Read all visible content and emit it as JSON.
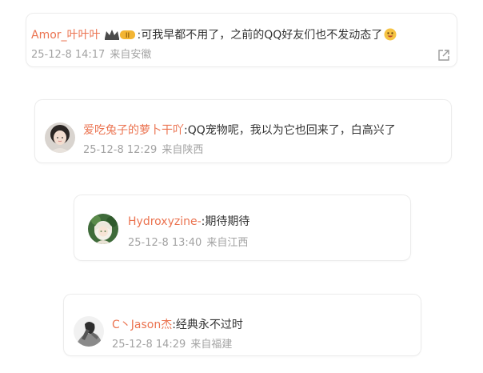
{
  "comments": [
    {
      "username": "Amor_叶叶叶",
      "badge": "II",
      "text": ":可我早都不用了，之前的QQ好友们也不发动态了",
      "time": "25-12-8 14:17",
      "location": "来自安徽",
      "has_emoji": true,
      "emoji_icon": "smile-emoji-icon",
      "has_share": true,
      "share_icon": "share-external-icon"
    },
    {
      "username": "爱吃兔子的萝卜干吖",
      "text": ":QQ宠物呢，我以为它也回来了，白高兴了",
      "time": "25-12-8 12:29",
      "location": "来自陕西",
      "avatar_icon": "avatar-girl-photo"
    },
    {
      "username": "Hydroxyzine-",
      "text": ":期待期待",
      "time": "25-12-8 13:40",
      "location": "来自江西",
      "avatar_icon": "avatar-anime-character"
    },
    {
      "username": "C丶Jason杰",
      "text": ":经典永不过时",
      "time": "25-12-8 14:29",
      "location": "来自福建",
      "avatar_icon": "avatar-sketch-figure"
    }
  ],
  "colors": {
    "username": "#eb7350",
    "text": "#333333",
    "meta": "#a3a3a3",
    "card_border": "#ececec"
  }
}
